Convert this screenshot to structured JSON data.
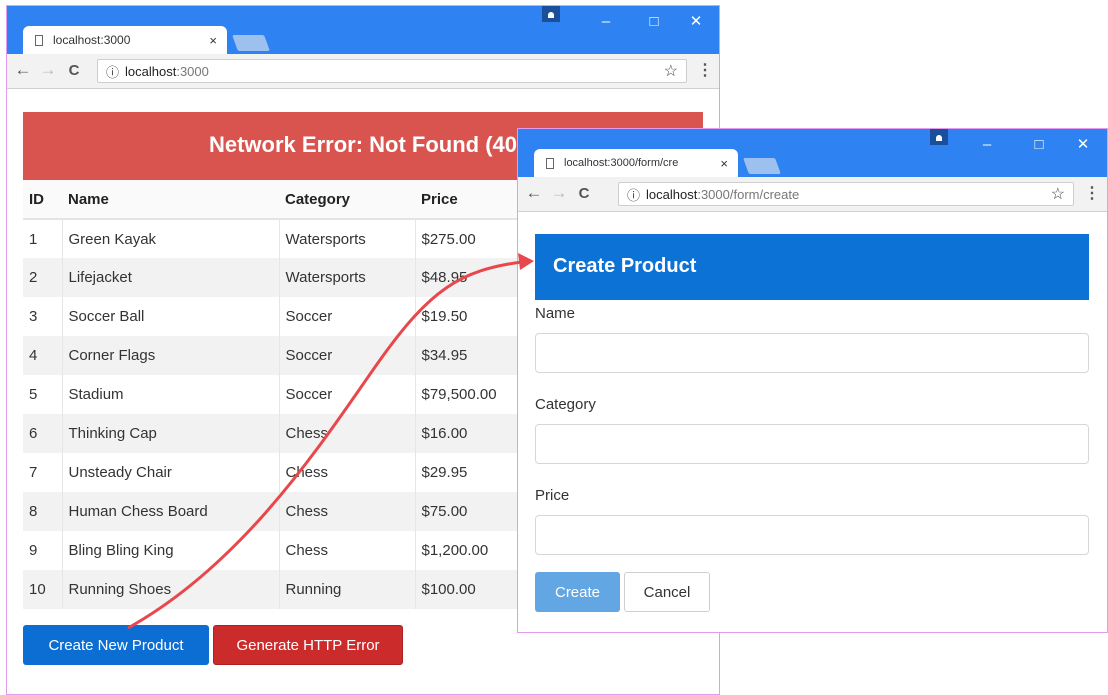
{
  "left_window": {
    "tab_title": "localhost:3000",
    "tab_close": "×",
    "url_host": "localhost",
    "url_path": ":3000",
    "window_buttons": {
      "minimize": "–",
      "maximize": "□",
      "close": "✕"
    },
    "nav": {
      "back": "←",
      "forward": "→",
      "reload": "C"
    },
    "info_icon": "ⓘ",
    "star": "☆",
    "menu": "⋮",
    "error_banner": "Network Error: Not Found (40",
    "table": {
      "headers": [
        "ID",
        "Name",
        "Category",
        "Price"
      ],
      "rows": [
        [
          "1",
          "Green Kayak",
          "Watersports",
          "$275.00"
        ],
        [
          "2",
          "Lifejacket",
          "Watersports",
          "$48.95"
        ],
        [
          "3",
          "Soccer Ball",
          "Soccer",
          "$19.50"
        ],
        [
          "4",
          "Corner Flags",
          "Soccer",
          "$34.95"
        ],
        [
          "5",
          "Stadium",
          "Soccer",
          "$79,500.00"
        ],
        [
          "6",
          "Thinking Cap",
          "Chess",
          "$16.00"
        ],
        [
          "7",
          "Unsteady Chair",
          "Chess",
          "$29.95"
        ],
        [
          "8",
          "Human Chess Board",
          "Chess",
          "$75.00"
        ],
        [
          "9",
          "Bling Bling King",
          "Chess",
          "$1,200.00"
        ],
        [
          "10",
          "Running Shoes",
          "Running",
          "$100.00"
        ]
      ]
    },
    "create_button": "Create New Product",
    "error_button": "Generate HTTP Error"
  },
  "right_window": {
    "tab_title": "localhost:3000/form/cre",
    "tab_close": "×",
    "url_host": "localhost",
    "url_path": ":3000/form/create",
    "window_buttons": {
      "minimize": "–",
      "maximize": "□",
      "close": "✕"
    },
    "nav": {
      "back": "←",
      "forward": "→",
      "reload": "C"
    },
    "info_icon": "ⓘ",
    "star": "☆",
    "menu": "⋮",
    "header": "Create Product",
    "fields": {
      "name": {
        "label": "Name",
        "value": ""
      },
      "category": {
        "label": "Category",
        "value": ""
      },
      "price": {
        "label": "Price",
        "value": ""
      }
    },
    "create_button": "Create",
    "cancel_button": "Cancel"
  },
  "colors": {
    "titlebar": "#2f82f2",
    "error": "#d9534f",
    "primary": "#0c6ed3",
    "arrow": "#e8474b"
  }
}
